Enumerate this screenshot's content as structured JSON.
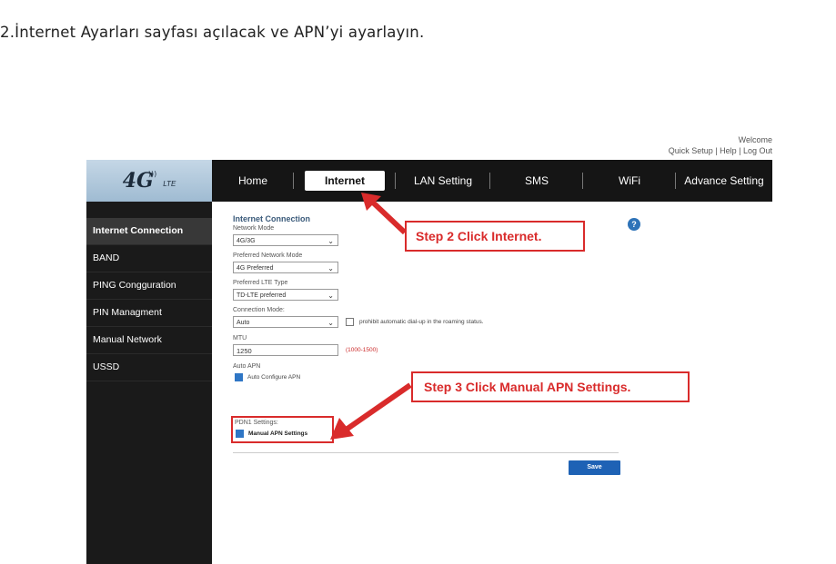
{
  "caption": "2.İnternet Ayarları sayfası açılacak ve APN’yi ayarlayın.",
  "welcome": {
    "text": "Welcome",
    "quick_setup": "Quick Setup",
    "help": "Help",
    "logout": "Log Out",
    "sep": " | "
  },
  "logo": {
    "big": "4G",
    "small": "LTE"
  },
  "nav": [
    {
      "label": "Home"
    },
    {
      "label": "Internet"
    },
    {
      "label": "LAN Setting"
    },
    {
      "label": "SMS"
    },
    {
      "label": "WiFi"
    },
    {
      "label": "Advance Setting"
    }
  ],
  "sidebar": [
    {
      "label": "Internet Connection"
    },
    {
      "label": "BAND"
    },
    {
      "label": "PING Congguration"
    },
    {
      "label": "PIN Managment"
    },
    {
      "label": "Manual Network"
    },
    {
      "label": "USSD"
    }
  ],
  "form": {
    "title": "Internet Connection",
    "network_mode": {
      "label": "Network Mode",
      "value": "4G/3G"
    },
    "preferred_network": {
      "label": "Preferred Network Mode",
      "value": "4G Preferred"
    },
    "preferred_lte": {
      "label": "Preferred LTE Type",
      "value": "TD-LTE preferred"
    },
    "connection_mode": {
      "label": "Connection Mode:",
      "value": "Auto",
      "roaming_text": "prohibit automatic dial-up in the roaming status."
    },
    "mtu": {
      "label": "MTU",
      "value": "1250",
      "range": "(1000-1500)"
    },
    "auto_apn": {
      "label": "Auto APN",
      "checkbox_label": "Auto Configure APN"
    },
    "pdn": {
      "label": "PDN1 Settings:",
      "checkbox_label": "Manual APN Settings"
    },
    "save": "Save",
    "help": "?"
  },
  "callouts": {
    "step2": "Step 2 Click Internet.",
    "step3": "Step 3 Click Manual APN Settings."
  },
  "colors": {
    "accent": "#d92b2b",
    "brand_blue": "#1e62b5",
    "nav_bg": "#151515"
  }
}
